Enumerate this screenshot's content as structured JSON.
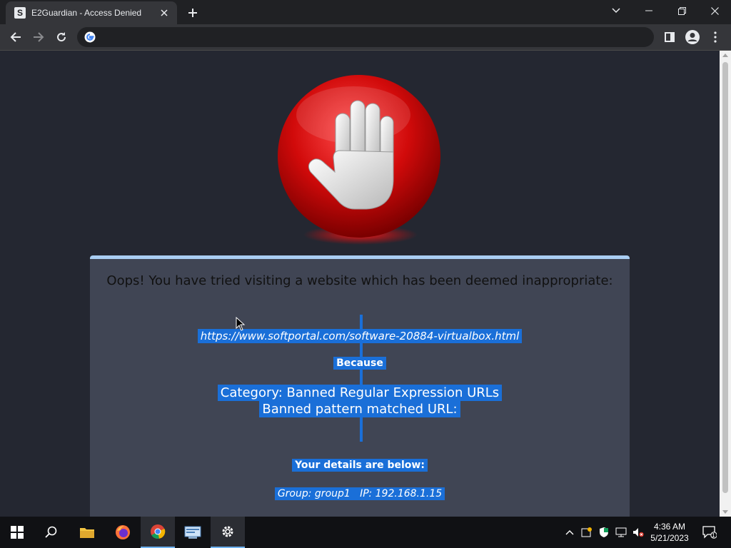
{
  "browser": {
    "tab_title": "E2Guardian - Access Denied",
    "favicon_letter": "S",
    "address": ""
  },
  "page": {
    "oops_text": "Oops! You have tried visiting a website which has been deemed inappropriate:",
    "blocked_url": "https://www.softportal.com/software-20884-virtualbox.html",
    "because_label": "Because",
    "category_text": "Category: Banned Regular Expression URLs",
    "pattern_text": "Banned pattern matched URL:",
    "details_label": "Your details are below:",
    "group_ip_text": "Group: group1   IP: 192.168.1.15"
  },
  "taskbar": {
    "time": "4:36 AM",
    "date": "5/21/2023",
    "notification_count": "1",
    "icons": [
      "windows-start-icon",
      "search-icon",
      "file-explorer-icon",
      "firefox-icon",
      "chrome-icon",
      "control-panel-icon",
      "settings-icon"
    ]
  },
  "colors": {
    "page_bg": "#242731",
    "panel_bg": "#404554",
    "panel_border": "#a9cdf2",
    "highlight": "#1a6fd8"
  }
}
